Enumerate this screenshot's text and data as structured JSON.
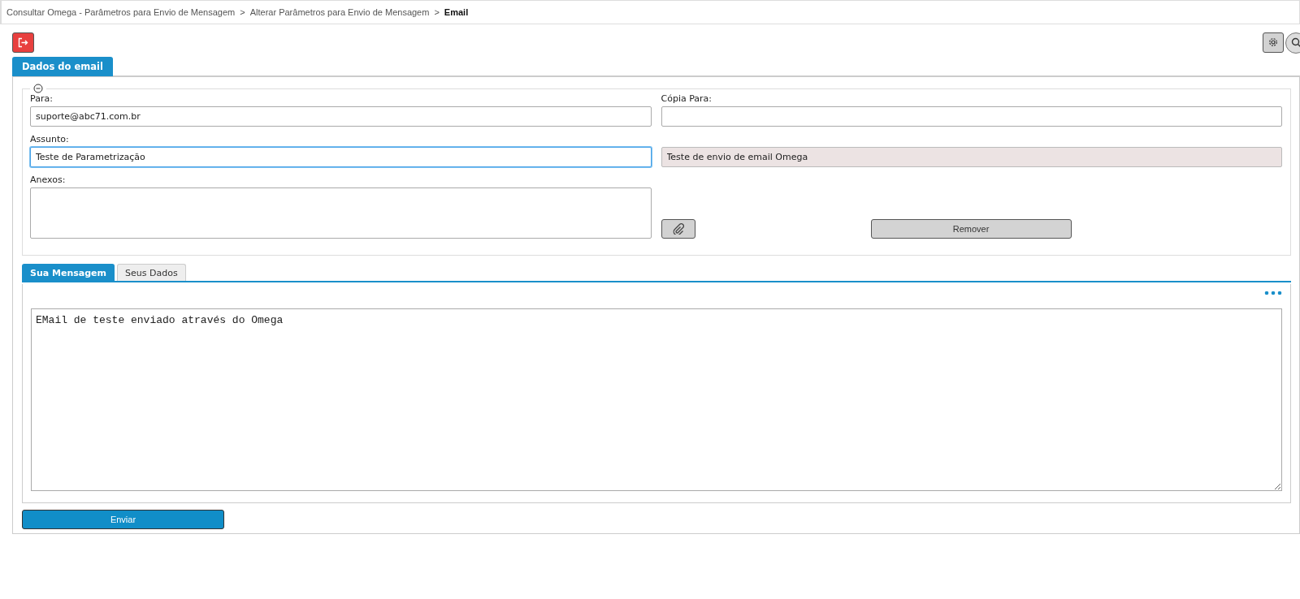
{
  "breadcrumb": {
    "separator": ">",
    "items": [
      {
        "label": "Consultar Omega - Parâmetros para Envio de Mensagem",
        "current": false
      },
      {
        "label": "Alterar Parâmetros para Envio de Mensagem",
        "current": false
      },
      {
        "label": "Email",
        "current": true
      }
    ]
  },
  "section_tab": {
    "label": "Dados do email",
    "selected": true
  },
  "fieldset": {
    "expanded": true,
    "fields": [
      {
        "kind": "text",
        "label": "Para:",
        "value": "suporte@abc71.com.br",
        "focused": false,
        "readonly": false
      },
      {
        "kind": "text",
        "label": "Cópia Para:",
        "focused": false,
        "readonly": false
      },
      {
        "kind": "text",
        "label": "Assunto:",
        "value": "Teste de Parametrização",
        "focused": true,
        "readonly": false
      },
      {
        "kind": "text",
        "value": "Teste de envio de email Omega",
        "focused": false,
        "readonly": true
      },
      {
        "kind": "area",
        "label": "Anexos:",
        "focused": false,
        "readonly": false
      }
    ],
    "remove_button": "Remover"
  },
  "tabs": [
    {
      "label": "Sua Mensagem",
      "selected": true
    },
    {
      "label": "Seus Dados",
      "selected": false
    }
  ],
  "message": "EMail de teste enviado através do Omega",
  "send_button": "Enviar"
}
